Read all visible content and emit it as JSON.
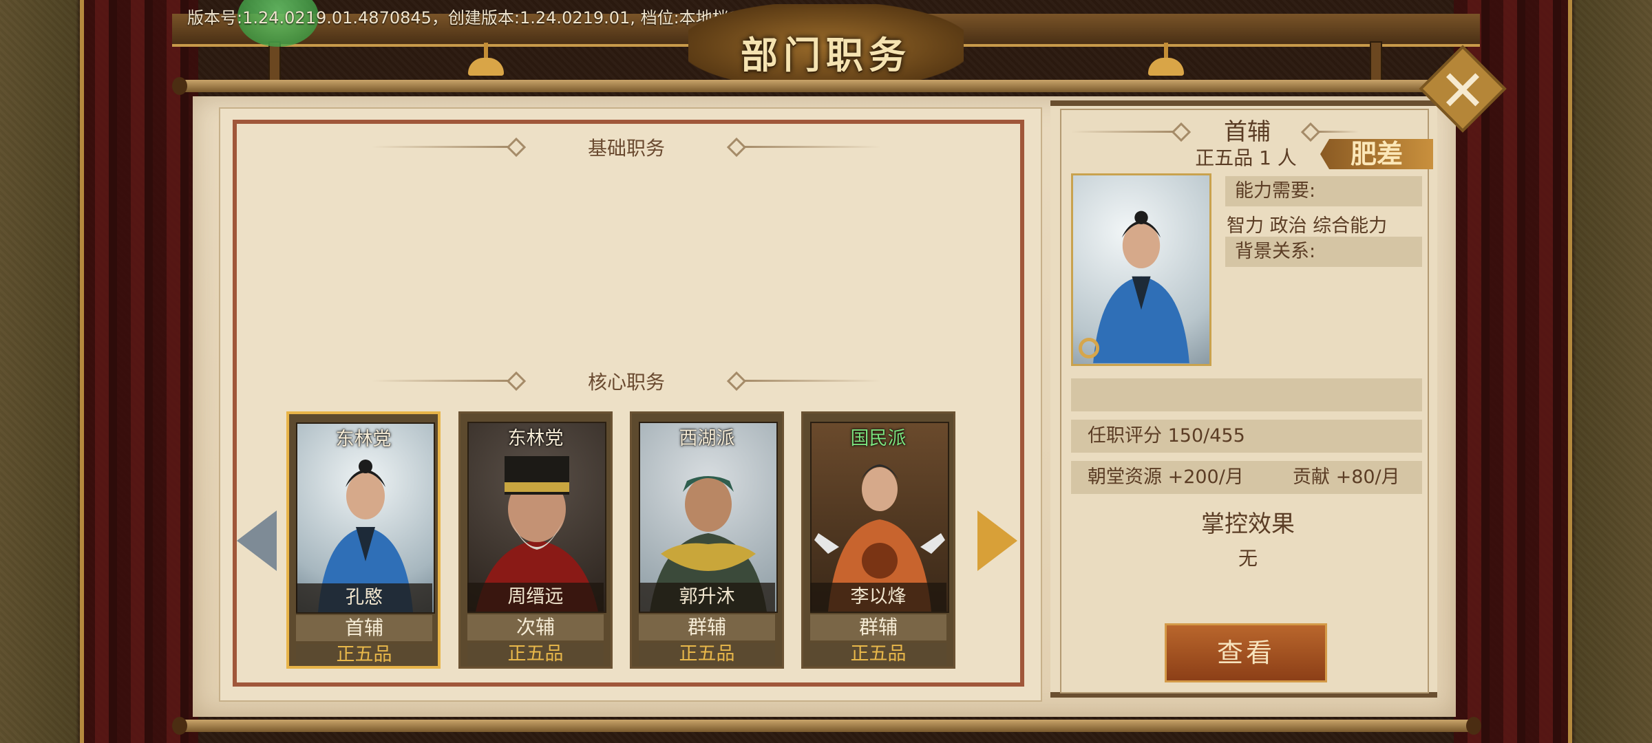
{
  "version_text": "版本号:1.24.0219.01.4870845，创建版本:1.24.0219.01, 档位:本地档1",
  "screen_title": "部门职务",
  "sections": {
    "basic": "基础职务",
    "core": "核心职务"
  },
  "officials": [
    {
      "faction": "东林党",
      "faction_color": "#f6ecd6",
      "name": "孔愍",
      "role": "首辅",
      "rank": "正五品",
      "selected": true,
      "robe": "#2f6fb7",
      "hat": "#1c1c1c"
    },
    {
      "faction": "东林党",
      "faction_color": "#f6ecd6",
      "name": "周缙远",
      "role": "次辅",
      "rank": "正五品",
      "selected": false,
      "robe": "#8a1a16",
      "hat": "#c9a640"
    },
    {
      "faction": "西湖派",
      "faction_color": "#f6ecd6",
      "name": "郭升沐",
      "role": "群辅",
      "rank": "正五品",
      "selected": false,
      "robe": "#3b4a3a",
      "hat": "#2f5e4e"
    },
    {
      "faction": "国民派",
      "faction_color": "#7de27e",
      "name": "李以烽",
      "role": "群辅",
      "rank": "正五品",
      "selected": false,
      "robe": "#c8642e",
      "hat": "#2a2a2a"
    }
  ],
  "detail": {
    "title": "首辅",
    "subtitle": "正五品 1 人",
    "tag": "肥差",
    "ability_label": "能力需要:",
    "abilities": "智力  政治  综合能力",
    "background_label": "背景关系:",
    "score": "任职评分   150/455",
    "resource": "朝堂资源 +200/月",
    "contribution": "贡献 +80/月",
    "effect_title": "掌控效果",
    "effect_value": "无",
    "view_button": "查看"
  },
  "icons": {
    "close": "close-icon",
    "prev": "arrow-left-icon",
    "next": "arrow-right-icon",
    "inspect": "magnifier-icon"
  }
}
